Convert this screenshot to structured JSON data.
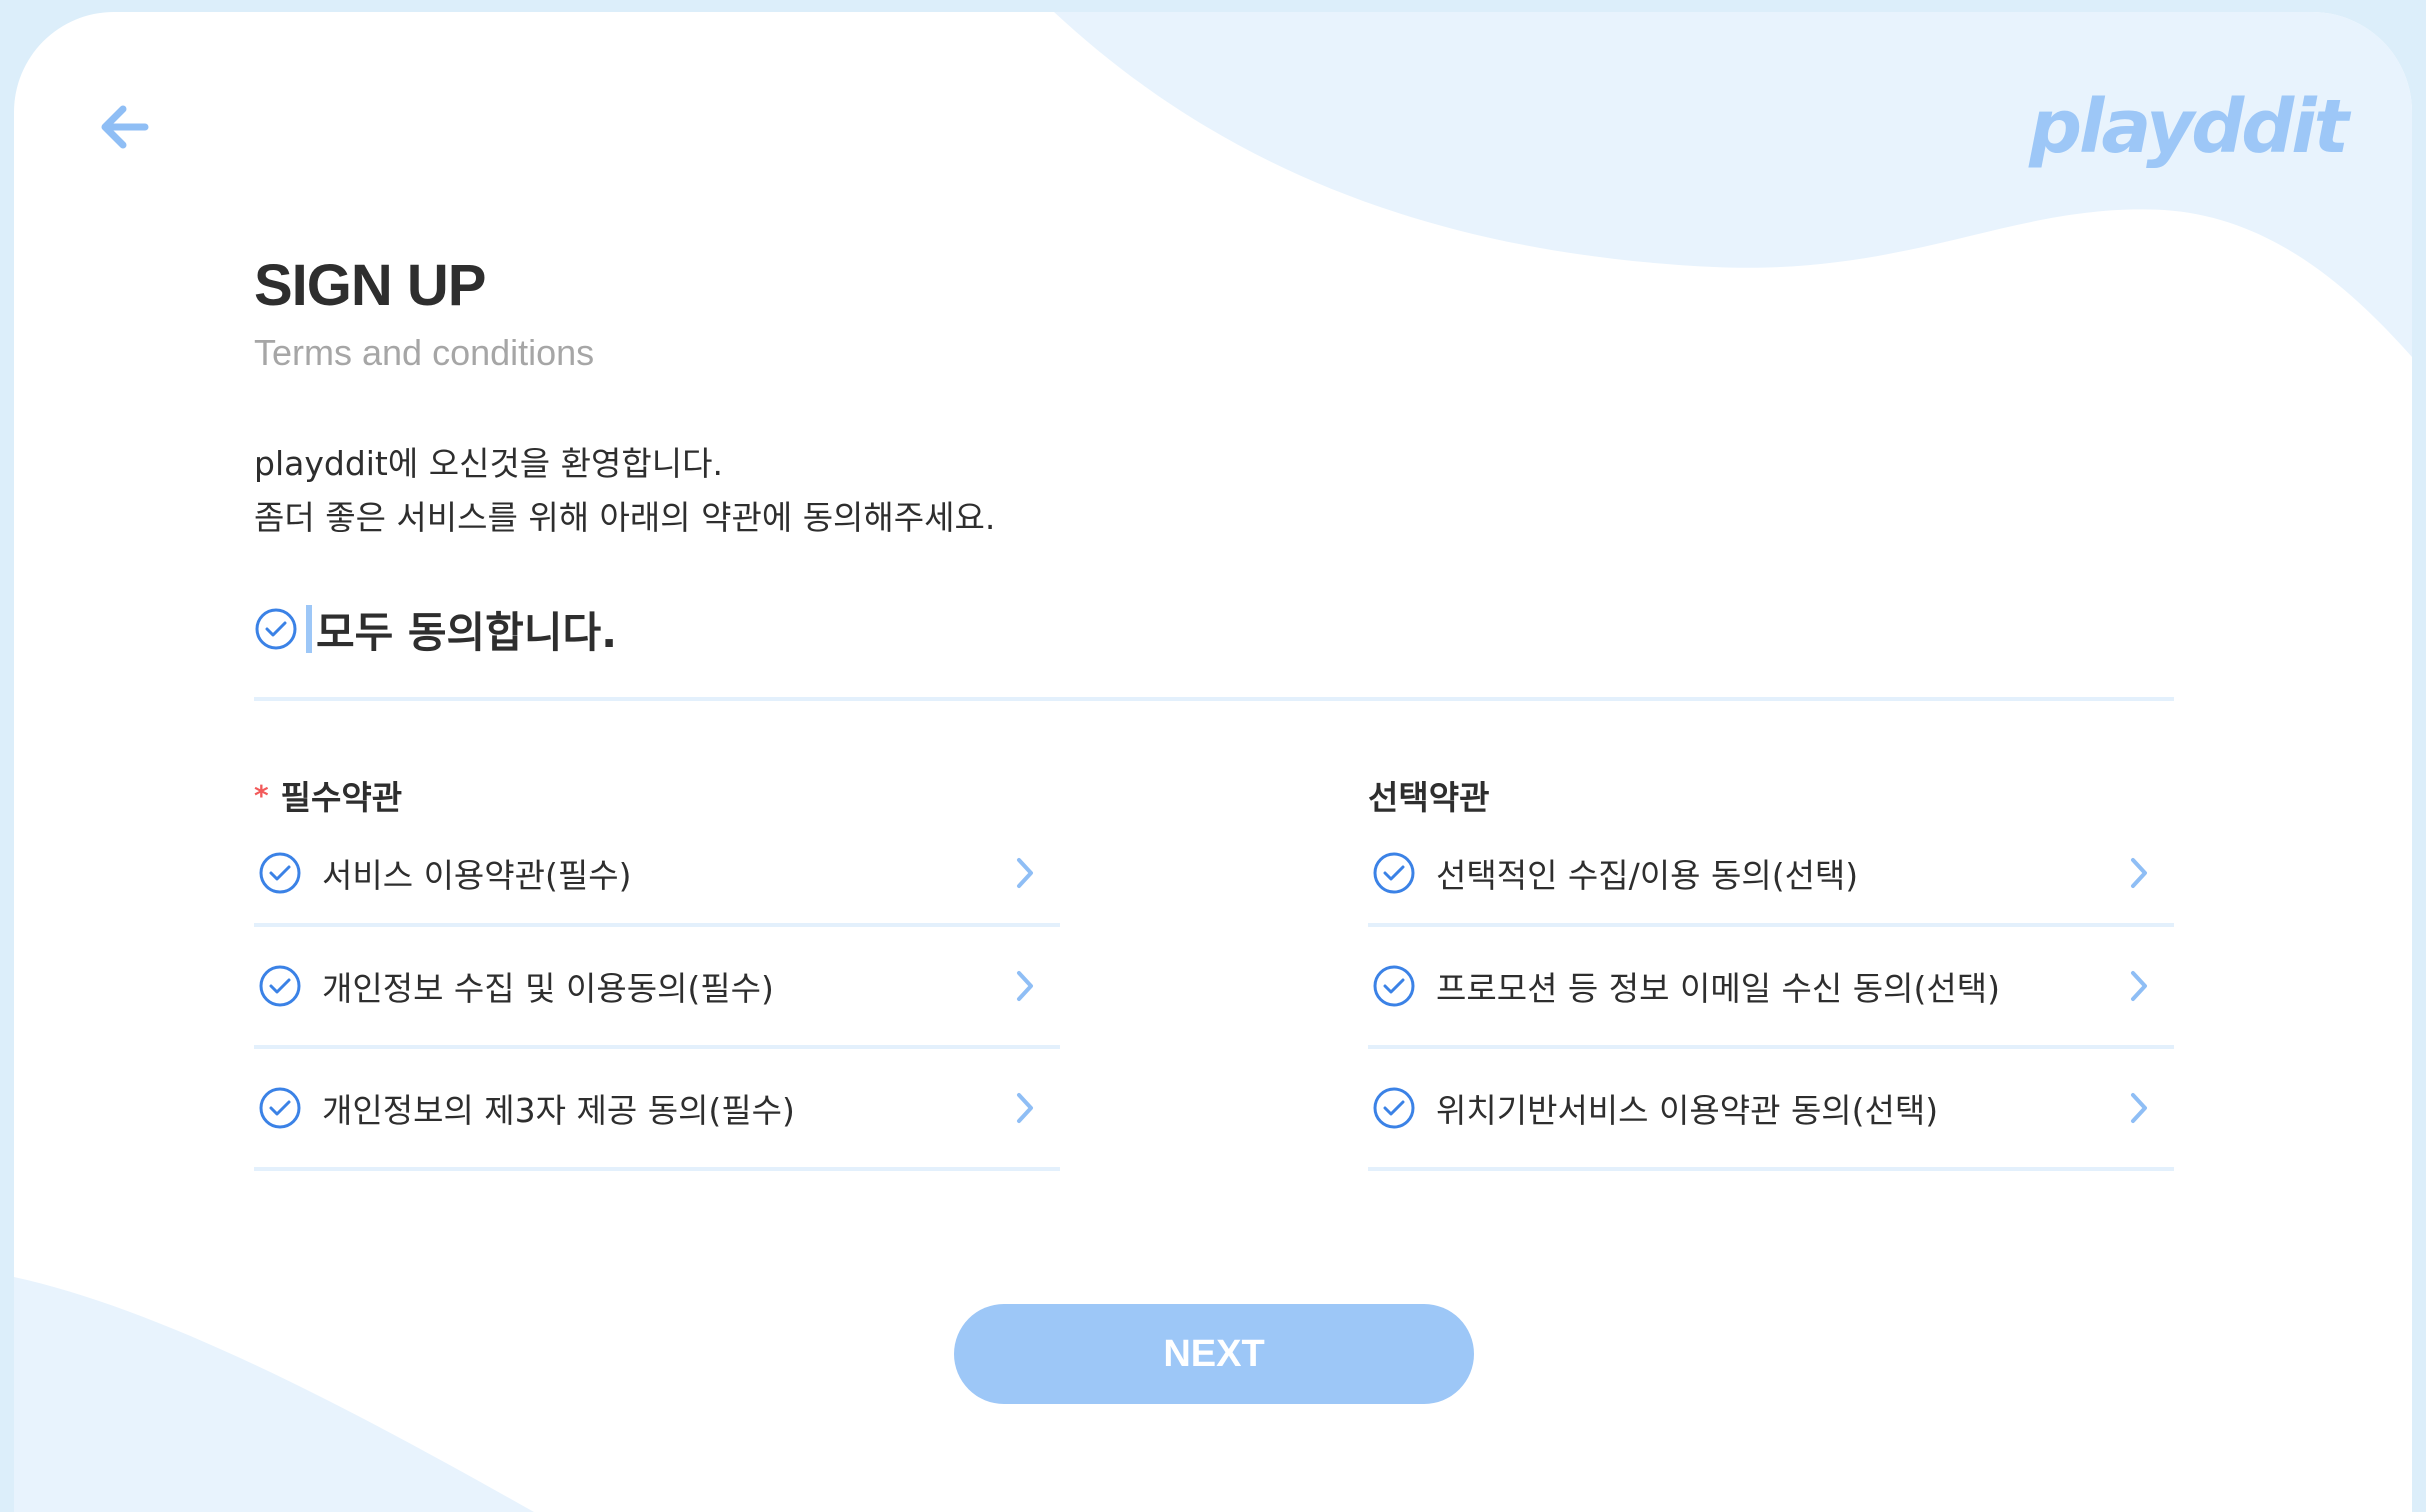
{
  "header": {
    "back_icon": "arrow-left-icon",
    "logo": "playddit"
  },
  "page": {
    "title": "SIGN UP",
    "subtitle": "Terms and conditions",
    "welcome_line1": "playddit에 오신것을 환영합니다.",
    "welcome_line2": "좀더 좋은 서비스를 위해 아래의 약관에 동의해주세요."
  },
  "agree_all": {
    "label": "모두 동의합니다.",
    "checked": false
  },
  "required": {
    "marker": "*",
    "title": "필수약관",
    "items": [
      {
        "label": "서비스 이용약관(필수)"
      },
      {
        "label": "개인정보 수집 및 이용동의(필수)"
      },
      {
        "label": "개인정보의 제3자 제공 동의(필수)"
      }
    ]
  },
  "optional": {
    "title": "선택약관",
    "items": [
      {
        "label": "선택적인 수집/이용 동의(선택)"
      },
      {
        "label": "프로모션 등 정보 이메일 수신 동의(선택)"
      },
      {
        "label": "위치기반서비스 이용약관 동의(선택)"
      }
    ]
  },
  "next_button": {
    "label": "NEXT",
    "enabled": false
  },
  "colors": {
    "accent": "#9dc7f7",
    "check": "#3b82e6",
    "required_marker": "#f25a5a",
    "text": "#2e2e2e",
    "muted": "#a6a6a6"
  }
}
